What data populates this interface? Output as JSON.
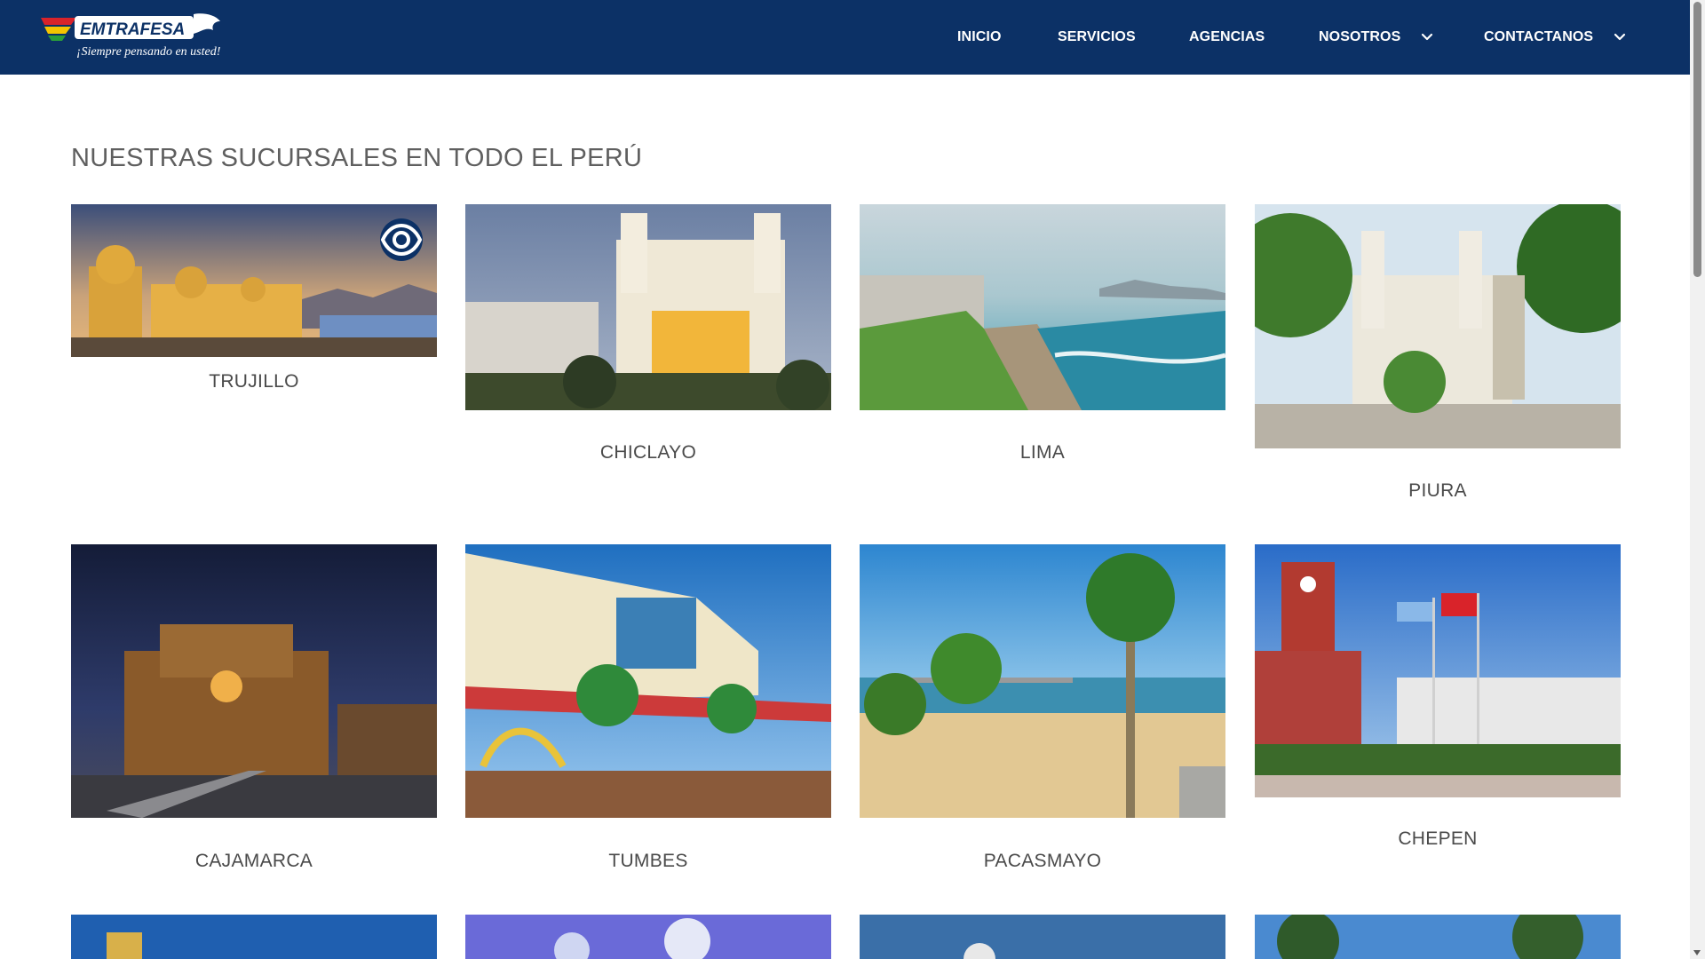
{
  "brand": {
    "name": "EMTRAFESA",
    "tagline": "¡Siempre pensando en usted!"
  },
  "nav": {
    "items": [
      {
        "label": "INICIO",
        "has_dropdown": false
      },
      {
        "label": "SERVICIOS",
        "has_dropdown": false
      },
      {
        "label": "AGENCIAS",
        "has_dropdown": false
      },
      {
        "label": "NOSOTROS",
        "has_dropdown": true
      },
      {
        "label": "CONTACTANOS",
        "has_dropdown": true
      }
    ]
  },
  "page": {
    "title": "NUESTRAS SUCURSALES EN TODO EL PERÚ"
  },
  "branches": [
    {
      "name": "TRUJILLO",
      "image": "trujillo-cathedral-photo",
      "hovered": true
    },
    {
      "name": "CHICLAYO",
      "image": "chiclayo-cathedral-night-photo"
    },
    {
      "name": "LIMA",
      "image": "lima-coastline-photo"
    },
    {
      "name": "PIURA",
      "image": "piura-plaza-church-photo"
    },
    {
      "name": "CAJAMARCA",
      "image": "cajamarca-cathedral-night-photo"
    },
    {
      "name": "TUMBES",
      "image": "tumbes-boardwalk-photo"
    },
    {
      "name": "PACASMAYO",
      "image": "pacasmayo-beach-palms-photo"
    },
    {
      "name": "CHEPEN",
      "image": "chepen-plaza-clock-tower-photo"
    },
    {
      "name": "",
      "image": "church-tower-photo"
    },
    {
      "name": "",
      "image": "plaza-sky-photo"
    },
    {
      "name": "",
      "image": "dome-church-photo"
    },
    {
      "name": "",
      "image": "palm-trees-photo"
    }
  ],
  "colors": {
    "header": "#0c3166",
    "title": "#5f5f5f",
    "label": "#4a4a4a",
    "accent_red": "#d9232a",
    "accent_yellow": "#f5c400"
  },
  "icons": {
    "view": "eye-icon",
    "dropdown": "chevron-down-icon"
  }
}
